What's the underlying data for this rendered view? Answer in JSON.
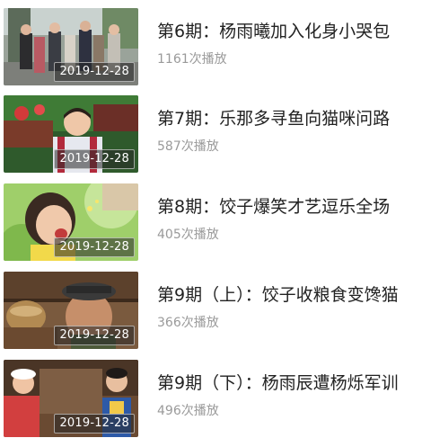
{
  "episodes": [
    {
      "title": "第6期：杨雨曦加入化身小哭包",
      "plays": "1161次播放",
      "date": "2019-12-28"
    },
    {
      "title": "第7期：乐那多寻鱼向猫咪问路",
      "plays": "587次播放",
      "date": "2019-12-28"
    },
    {
      "title": "第8期：饺子爆笑才艺逗乐全场",
      "plays": "405次播放",
      "date": "2019-12-28"
    },
    {
      "title": "第9期（上）：饺子收粮食变馋猫",
      "plays": "366次播放",
      "date": "2019-12-28"
    },
    {
      "title": "第9期（下）：杨雨辰遭杨烁军训",
      "plays": "496次播放",
      "date": "2019-12-28"
    }
  ]
}
